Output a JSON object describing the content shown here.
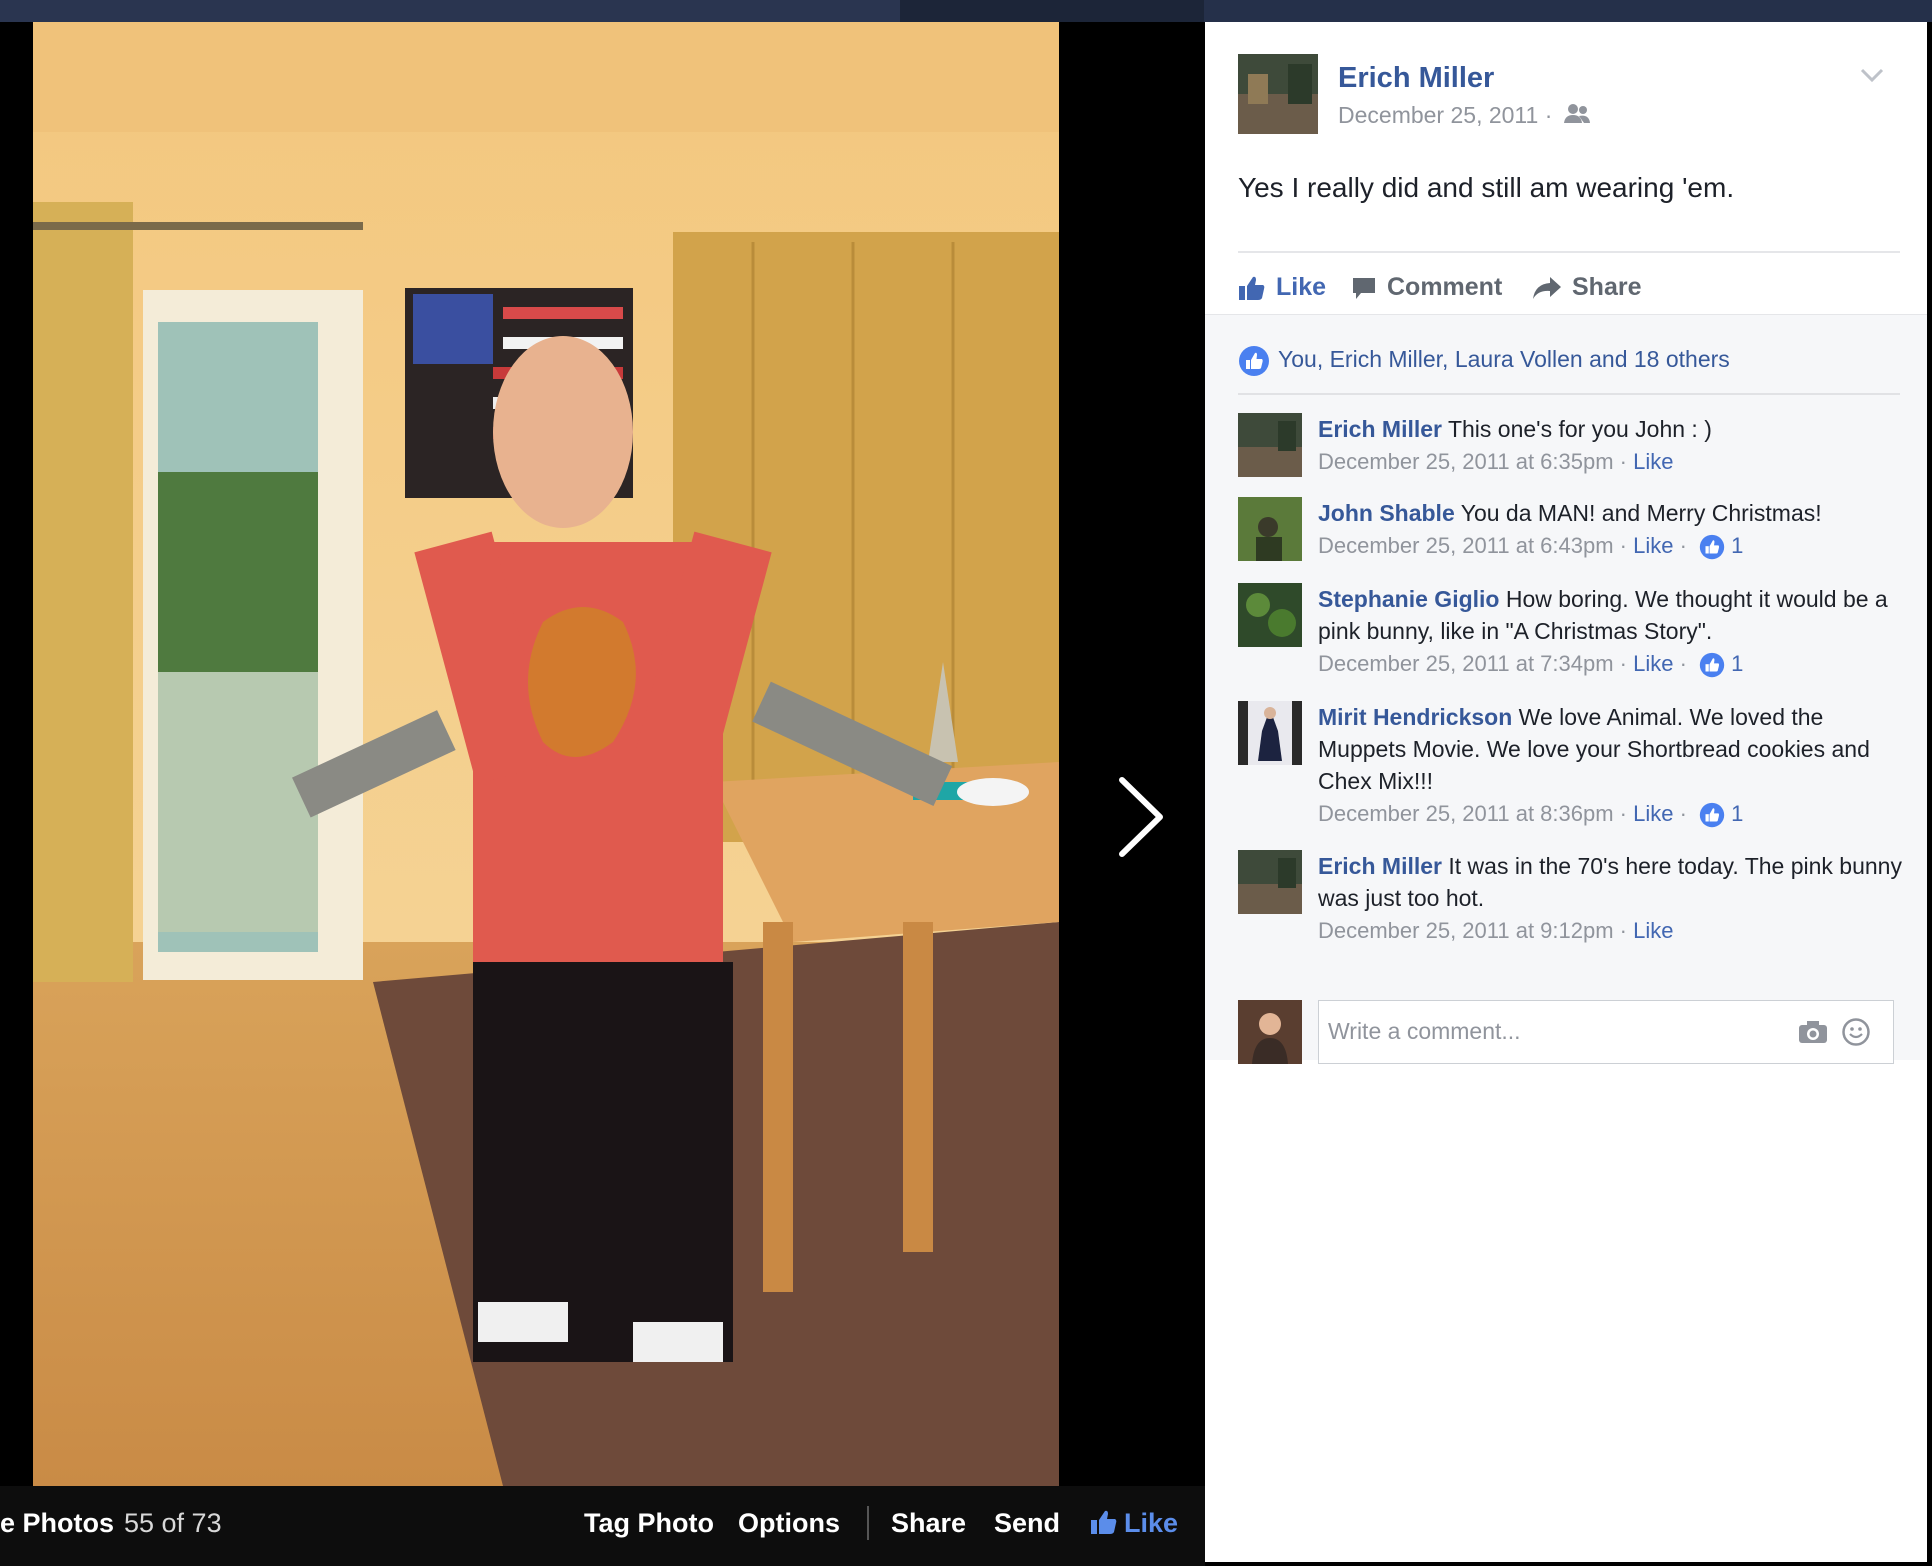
{
  "photobar": {
    "album_label": "e Photos",
    "position_text": "55 of 73",
    "tag_photo": "Tag Photo",
    "options": "Options",
    "share": "Share",
    "send": "Send",
    "like": "Like"
  },
  "post": {
    "author": "Erich Miller",
    "date": "December 25, 2011 ·",
    "audience_icon": "friends-icon",
    "text": "Yes I really did and still am wearing 'em."
  },
  "actions": {
    "like": "Like",
    "comment": "Comment",
    "share": "Share"
  },
  "likes_summary": "You, Erich Miller, Laura Vollen and 18 others",
  "comments": [
    {
      "author": "Erich Miller",
      "text": "This one's for you John : )",
      "time": "December 25, 2011 at 6:35pm",
      "sep": " · ",
      "like": "Like",
      "reactions": ""
    },
    {
      "author": "John Shable",
      "text": "You da MAN! and Merry Christmas!",
      "time": "December 25, 2011 at 6:43pm",
      "sep": " · ",
      "like": "Like",
      "reactions": "1"
    },
    {
      "author": "Stephanie Giglio",
      "text": "How boring. We thought it would be a pink bunny, like in \"A Christmas Story\".",
      "time": "December 25, 2011 at 7:34pm",
      "sep": " · ",
      "like": "Like",
      "reactions": "1"
    },
    {
      "author": "Mirit Hendrickson",
      "text": "We love Animal. We loved the Muppets Movie. We love your Shortbread cookies and Chex Mix!!!",
      "time": "December 25, 2011 at 8:36pm",
      "sep": " · ",
      "like": "Like",
      "reactions": "1"
    },
    {
      "author": "Erich Miller",
      "text": "It was in the 70's here today. The pink bunny was just too hot.",
      "time": "December 25, 2011 at 9:12pm",
      "sep": " · ",
      "like": "Like",
      "reactions": ""
    }
  ],
  "composer": {
    "placeholder": "Write a comment..."
  },
  "colors": {
    "link": "#365899",
    "accent": "#4267b2",
    "meta": "#90949c"
  }
}
